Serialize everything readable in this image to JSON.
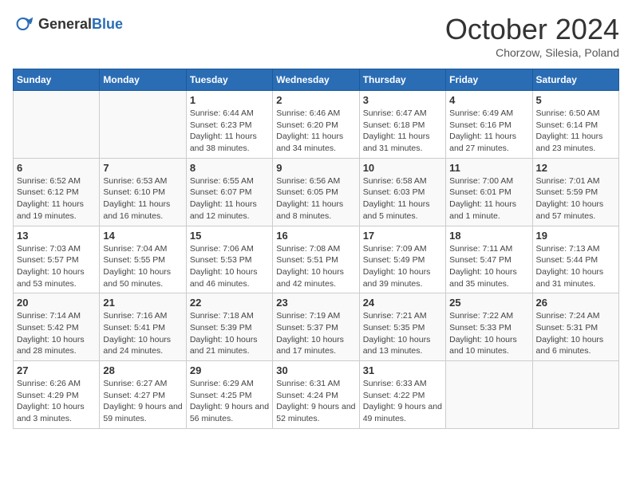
{
  "header": {
    "logo_general": "General",
    "logo_blue": "Blue",
    "month_title": "October 2024",
    "location": "Chorzow, Silesia, Poland"
  },
  "weekdays": [
    "Sunday",
    "Monday",
    "Tuesday",
    "Wednesday",
    "Thursday",
    "Friday",
    "Saturday"
  ],
  "weeks": [
    [
      {
        "day": "",
        "sunrise": "",
        "sunset": "",
        "daylight": ""
      },
      {
        "day": "",
        "sunrise": "",
        "sunset": "",
        "daylight": ""
      },
      {
        "day": "1",
        "sunrise": "Sunrise: 6:44 AM",
        "sunset": "Sunset: 6:23 PM",
        "daylight": "Daylight: 11 hours and 38 minutes."
      },
      {
        "day": "2",
        "sunrise": "Sunrise: 6:46 AM",
        "sunset": "Sunset: 6:20 PM",
        "daylight": "Daylight: 11 hours and 34 minutes."
      },
      {
        "day": "3",
        "sunrise": "Sunrise: 6:47 AM",
        "sunset": "Sunset: 6:18 PM",
        "daylight": "Daylight: 11 hours and 31 minutes."
      },
      {
        "day": "4",
        "sunrise": "Sunrise: 6:49 AM",
        "sunset": "Sunset: 6:16 PM",
        "daylight": "Daylight: 11 hours and 27 minutes."
      },
      {
        "day": "5",
        "sunrise": "Sunrise: 6:50 AM",
        "sunset": "Sunset: 6:14 PM",
        "daylight": "Daylight: 11 hours and 23 minutes."
      }
    ],
    [
      {
        "day": "6",
        "sunrise": "Sunrise: 6:52 AM",
        "sunset": "Sunset: 6:12 PM",
        "daylight": "Daylight: 11 hours and 19 minutes."
      },
      {
        "day": "7",
        "sunrise": "Sunrise: 6:53 AM",
        "sunset": "Sunset: 6:10 PM",
        "daylight": "Daylight: 11 hours and 16 minutes."
      },
      {
        "day": "8",
        "sunrise": "Sunrise: 6:55 AM",
        "sunset": "Sunset: 6:07 PM",
        "daylight": "Daylight: 11 hours and 12 minutes."
      },
      {
        "day": "9",
        "sunrise": "Sunrise: 6:56 AM",
        "sunset": "Sunset: 6:05 PM",
        "daylight": "Daylight: 11 hours and 8 minutes."
      },
      {
        "day": "10",
        "sunrise": "Sunrise: 6:58 AM",
        "sunset": "Sunset: 6:03 PM",
        "daylight": "Daylight: 11 hours and 5 minutes."
      },
      {
        "day": "11",
        "sunrise": "Sunrise: 7:00 AM",
        "sunset": "Sunset: 6:01 PM",
        "daylight": "Daylight: 11 hours and 1 minute."
      },
      {
        "day": "12",
        "sunrise": "Sunrise: 7:01 AM",
        "sunset": "Sunset: 5:59 PM",
        "daylight": "Daylight: 10 hours and 57 minutes."
      }
    ],
    [
      {
        "day": "13",
        "sunrise": "Sunrise: 7:03 AM",
        "sunset": "Sunset: 5:57 PM",
        "daylight": "Daylight: 10 hours and 53 minutes."
      },
      {
        "day": "14",
        "sunrise": "Sunrise: 7:04 AM",
        "sunset": "Sunset: 5:55 PM",
        "daylight": "Daylight: 10 hours and 50 minutes."
      },
      {
        "day": "15",
        "sunrise": "Sunrise: 7:06 AM",
        "sunset": "Sunset: 5:53 PM",
        "daylight": "Daylight: 10 hours and 46 minutes."
      },
      {
        "day": "16",
        "sunrise": "Sunrise: 7:08 AM",
        "sunset": "Sunset: 5:51 PM",
        "daylight": "Daylight: 10 hours and 42 minutes."
      },
      {
        "day": "17",
        "sunrise": "Sunrise: 7:09 AM",
        "sunset": "Sunset: 5:49 PM",
        "daylight": "Daylight: 10 hours and 39 minutes."
      },
      {
        "day": "18",
        "sunrise": "Sunrise: 7:11 AM",
        "sunset": "Sunset: 5:47 PM",
        "daylight": "Daylight: 10 hours and 35 minutes."
      },
      {
        "day": "19",
        "sunrise": "Sunrise: 7:13 AM",
        "sunset": "Sunset: 5:44 PM",
        "daylight": "Daylight: 10 hours and 31 minutes."
      }
    ],
    [
      {
        "day": "20",
        "sunrise": "Sunrise: 7:14 AM",
        "sunset": "Sunset: 5:42 PM",
        "daylight": "Daylight: 10 hours and 28 minutes."
      },
      {
        "day": "21",
        "sunrise": "Sunrise: 7:16 AM",
        "sunset": "Sunset: 5:41 PM",
        "daylight": "Daylight: 10 hours and 24 minutes."
      },
      {
        "day": "22",
        "sunrise": "Sunrise: 7:18 AM",
        "sunset": "Sunset: 5:39 PM",
        "daylight": "Daylight: 10 hours and 21 minutes."
      },
      {
        "day": "23",
        "sunrise": "Sunrise: 7:19 AM",
        "sunset": "Sunset: 5:37 PM",
        "daylight": "Daylight: 10 hours and 17 minutes."
      },
      {
        "day": "24",
        "sunrise": "Sunrise: 7:21 AM",
        "sunset": "Sunset: 5:35 PM",
        "daylight": "Daylight: 10 hours and 13 minutes."
      },
      {
        "day": "25",
        "sunrise": "Sunrise: 7:22 AM",
        "sunset": "Sunset: 5:33 PM",
        "daylight": "Daylight: 10 hours and 10 minutes."
      },
      {
        "day": "26",
        "sunrise": "Sunrise: 7:24 AM",
        "sunset": "Sunset: 5:31 PM",
        "daylight": "Daylight: 10 hours and 6 minutes."
      }
    ],
    [
      {
        "day": "27",
        "sunrise": "Sunrise: 6:26 AM",
        "sunset": "Sunset: 4:29 PM",
        "daylight": "Daylight: 10 hours and 3 minutes."
      },
      {
        "day": "28",
        "sunrise": "Sunrise: 6:27 AM",
        "sunset": "Sunset: 4:27 PM",
        "daylight": "Daylight: 9 hours and 59 minutes."
      },
      {
        "day": "29",
        "sunrise": "Sunrise: 6:29 AM",
        "sunset": "Sunset: 4:25 PM",
        "daylight": "Daylight: 9 hours and 56 minutes."
      },
      {
        "day": "30",
        "sunrise": "Sunrise: 6:31 AM",
        "sunset": "Sunset: 4:24 PM",
        "daylight": "Daylight: 9 hours and 52 minutes."
      },
      {
        "day": "31",
        "sunrise": "Sunrise: 6:33 AM",
        "sunset": "Sunset: 4:22 PM",
        "daylight": "Daylight: 9 hours and 49 minutes."
      },
      {
        "day": "",
        "sunrise": "",
        "sunset": "",
        "daylight": ""
      },
      {
        "day": "",
        "sunrise": "",
        "sunset": "",
        "daylight": ""
      }
    ]
  ]
}
